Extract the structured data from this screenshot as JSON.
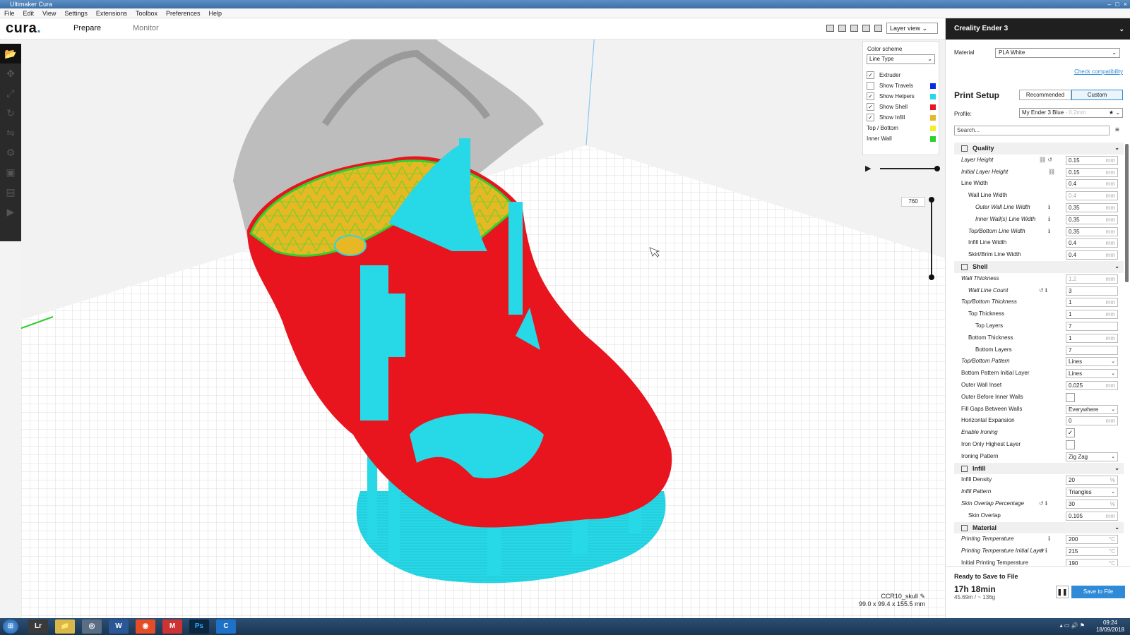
{
  "window": {
    "title": "Ultimaker Cura",
    "controls": [
      "–",
      "□",
      "×"
    ]
  },
  "menu": [
    "File",
    "Edit",
    "View",
    "Settings",
    "Extensions",
    "Toolbox",
    "Preferences",
    "Help"
  ],
  "header": {
    "logo": "cura",
    "tabs": [
      "Prepare",
      "Monitor"
    ],
    "view_mode": "Layer view ⌄"
  },
  "color_panel": {
    "label": "Color scheme",
    "selected": "Line Type",
    "rows": [
      {
        "label": "Extruder",
        "checked": true,
        "color": null
      },
      {
        "label": "Show Travels",
        "checked": false,
        "color": "#0a2be6"
      },
      {
        "label": "Show Helpers",
        "checked": true,
        "color": "#27d8e6"
      },
      {
        "label": "Show Shell",
        "checked": true,
        "color": "#e8141e"
      },
      {
        "label": "Show Infill",
        "checked": true,
        "color": "#e8b824"
      },
      {
        "label": "Top / Bottom",
        "checked": null,
        "color": "#f2ee2a"
      },
      {
        "label": "Inner Wall",
        "checked": null,
        "color": "#2ed12e"
      }
    ]
  },
  "layer": {
    "current": "760",
    "progress": 1.0
  },
  "file": {
    "name": "CCR10_skull",
    "dims": "99.0 x 99.4 x 155.5 mm"
  },
  "sidebar": {
    "printer": "Creality Ender 3",
    "material_label": "Material",
    "material": "PLA White",
    "compat": "Check compatibility",
    "print_setup": "Print Setup",
    "mode_recommended": "Recommended",
    "mode_custom": "Custom",
    "profile_label": "Profile:",
    "profile": "My Ender 3 Blue",
    "profile_sub": "- 0.2mm",
    "search_placeholder": "Search...",
    "settings": [
      {
        "type": "cat",
        "label": "Quality"
      },
      {
        "label": "Layer Height",
        "value": "0.15",
        "unit": "mm",
        "indent": 0,
        "italic": true,
        "icons": "⛓ ↺"
      },
      {
        "label": "Initial Layer Height",
        "value": "0.15",
        "unit": "mm",
        "indent": 0,
        "italic": true,
        "icons": "⛓"
      },
      {
        "label": "Line Width",
        "value": "0.4",
        "unit": "mm",
        "indent": 0
      },
      {
        "label": "Wall Line Width",
        "value": "0.4",
        "unit": "mm",
        "indent": 1,
        "disabled": true
      },
      {
        "label": "Outer Wall Line Width",
        "value": "0.35",
        "unit": "mm",
        "indent": 2,
        "italic": true,
        "icons": "ℹ"
      },
      {
        "label": "Inner Wall(s) Line Width",
        "value": "0.35",
        "unit": "mm",
        "indent": 2,
        "italic": true,
        "icons": "ℹ"
      },
      {
        "label": "Top/Bottom Line Width",
        "value": "0.35",
        "unit": "mm",
        "indent": 1,
        "italic": true,
        "icons": "ℹ"
      },
      {
        "label": "Infill Line Width",
        "value": "0.4",
        "unit": "mm",
        "indent": 1
      },
      {
        "label": "Skirt/Brim Line Width",
        "value": "0.4",
        "unit": "mm",
        "indent": 1
      },
      {
        "type": "cat",
        "label": "Shell"
      },
      {
        "label": "Wall Thickness",
        "value": "1.2",
        "unit": "mm",
        "indent": 0,
        "italic": true,
        "disabled": true
      },
      {
        "label": "Wall Line Count",
        "value": "3",
        "unit": "",
        "indent": 1,
        "italic": true,
        "icons": "↺ ℹ"
      },
      {
        "label": "Top/Bottom Thickness",
        "value": "1",
        "unit": "mm",
        "indent": 0,
        "italic": true
      },
      {
        "label": "Top Thickness",
        "value": "1",
        "unit": "mm",
        "indent": 1
      },
      {
        "label": "Top Layers",
        "value": "7",
        "unit": "",
        "indent": 2
      },
      {
        "label": "Bottom Thickness",
        "value": "1",
        "unit": "mm",
        "indent": 1
      },
      {
        "label": "Bottom Layers",
        "value": "7",
        "unit": "",
        "indent": 2
      },
      {
        "label": "Top/Bottom Pattern",
        "value": "Lines",
        "dropdown": true,
        "indent": 0,
        "italic": true
      },
      {
        "label": "Bottom Pattern Initial Layer",
        "value": "Lines",
        "dropdown": true,
        "indent": 0
      },
      {
        "label": "Outer Wall Inset",
        "value": "0.025",
        "unit": "mm",
        "indent": 0
      },
      {
        "label": "Outer Before Inner Walls",
        "checkbox": false,
        "indent": 0
      },
      {
        "label": "Fill Gaps Between Walls",
        "value": "Everywhere",
        "dropdown": true,
        "indent": 0
      },
      {
        "label": "Horizontal Expansion",
        "value": "0",
        "unit": "mm",
        "indent": 0
      },
      {
        "label": "Enable Ironing",
        "checkbox": true,
        "indent": 0,
        "italic": true
      },
      {
        "label": "Iron Only Highest Layer",
        "checkbox": false,
        "indent": 0
      },
      {
        "label": "Ironing Pattern",
        "value": "Zig Zag",
        "dropdown": true,
        "indent": 0
      },
      {
        "type": "cat",
        "label": "Infill"
      },
      {
        "label": "Infill Density",
        "value": "20",
        "unit": "%",
        "indent": 0
      },
      {
        "label": "Infill Pattern",
        "value": "Triangles",
        "dropdown": true,
        "indent": 0,
        "italic": true
      },
      {
        "label": "Skin Overlap Percentage",
        "value": "30",
        "unit": "%",
        "indent": 0,
        "italic": true,
        "icons": "↺ ℹ"
      },
      {
        "label": "Skin Overlap",
        "value": "0.105",
        "unit": "mm",
        "indent": 1
      },
      {
        "type": "cat",
        "label": "Material"
      },
      {
        "label": "Printing Temperature",
        "value": "200",
        "unit": "°C",
        "indent": 0,
        "italic": true,
        "icons": "ℹ"
      },
      {
        "label": "Printing Temperature Initial Layer",
        "value": "215",
        "unit": "°C",
        "indent": 0,
        "italic": true,
        "icons": "↺ ℹ"
      },
      {
        "label": "Initial Printing Temperature",
        "value": "190",
        "unit": "°C",
        "indent": 0
      }
    ],
    "status": "Ready to Save to File",
    "time": "17h 18min",
    "usage": "45.69m / ~ 136g",
    "save_label": "Save to File"
  },
  "taskbar": {
    "time": "09:24",
    "date": "18/09/2018",
    "apps": [
      "Lr",
      "📁",
      "◎",
      "W",
      "◉",
      "M",
      "Ps",
      "C"
    ]
  },
  "colors": {
    "accent": "#2f8ad7",
    "shell": "#e8141e",
    "helpers": "#27d8e6",
    "infill": "#e8b824",
    "inner_wall": "#2ed12e"
  }
}
